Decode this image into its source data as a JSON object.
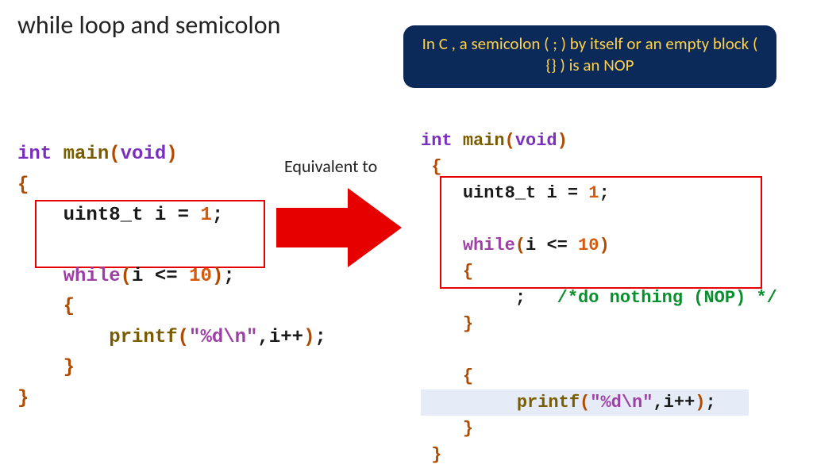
{
  "title": "while loop and semicolon",
  "callout": "In C , a semicolon ( ; ) by itself or an empty block ( {} ) is an NOP",
  "equivalent_label": "Equivalent to",
  "code_left": {
    "l1": {
      "t_int": "int",
      "fn": "main",
      "po": "(",
      "t_void": "void",
      "pc": ")"
    },
    "l2": {
      "brace_o": "{"
    },
    "l3": {
      "t_u8": "uint8_t",
      "id": "i",
      "eq": "=",
      "n1": "1",
      "sc": ";"
    },
    "l4": {
      "kw_while": "while",
      "po": "(",
      "id": "i",
      "op_le": "<=",
      "n10": "10",
      "pc": ")",
      "sc": ";"
    },
    "l5": {
      "brace_o": "{"
    },
    "l6": {
      "fn_printf": "printf",
      "po": "(",
      "str": "\"%d\\n\"",
      "comma": ",",
      "id": "i",
      "op_pp": "++",
      "pc": ")",
      "sc": ";"
    },
    "l7": {
      "brace_c": "}"
    },
    "l8": {
      "brace_c": "}"
    }
  },
  "code_right": {
    "l1": {
      "t_int": "int",
      "fn": "main",
      "po": "(",
      "t_void": "void",
      "pc": ")"
    },
    "l2": {
      "brace_o": "{"
    },
    "l3": {
      "t_u8": "uint8_t",
      "id": "i",
      "eq": "=",
      "n1": "1",
      "sc": ";"
    },
    "l4": {
      "kw_while": "while",
      "po": "(",
      "id": "i",
      "op_le": "<=",
      "n10": "10",
      "pc": ")"
    },
    "l5": {
      "brace_o": "{"
    },
    "l6": {
      "sc": ";",
      "comment": "/*do nothing (NOP) */"
    },
    "l7": {
      "brace_c": "}"
    },
    "l8": {
      "brace_o": "{"
    },
    "l9": {
      "fn_printf": "printf",
      "po": "(",
      "str": "\"%d\\n\"",
      "comma": ",",
      "id": "i",
      "op_pp": "++",
      "pc": ")",
      "sc": ";"
    },
    "l10": {
      "brace_c": "}"
    },
    "l11": {
      "brace_c": "}"
    }
  }
}
